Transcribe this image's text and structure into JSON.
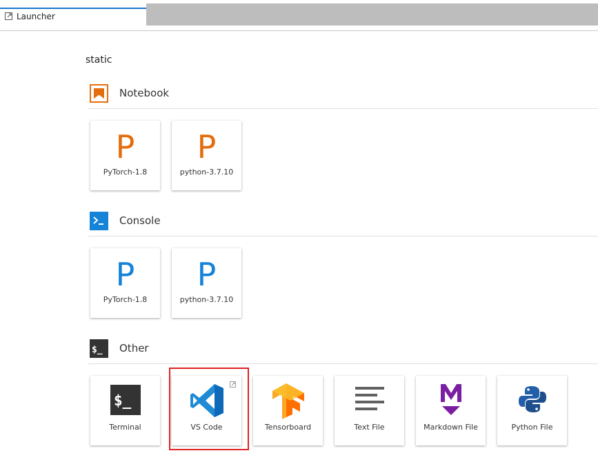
{
  "tab": {
    "label": "Launcher",
    "icon": "launcher-icon"
  },
  "section_root": "static",
  "colors": {
    "notebook": "#e46e0d",
    "console": "#1583d8",
    "other": "#333333",
    "highlight": "#e02020",
    "tab_accent": "#1976d2"
  },
  "sections": {
    "notebook": {
      "title": "Notebook",
      "icon": "notebook-icon",
      "items": [
        {
          "glyph": "P",
          "label": "PyTorch-1.8"
        },
        {
          "glyph": "P",
          "label": "python-3.7.10"
        }
      ]
    },
    "console": {
      "title": "Console",
      "icon": "console-icon",
      "items": [
        {
          "glyph": "P",
          "label": "PyTorch-1.8"
        },
        {
          "glyph": "P",
          "label": "python-3.7.10"
        }
      ]
    },
    "other": {
      "title": "Other",
      "icon": "terminal-prompt-icon",
      "items": [
        {
          "label": "Terminal",
          "icon": "terminal-icon"
        },
        {
          "label": "VS Code",
          "icon": "vscode-icon"
        },
        {
          "label": "Tensorboard",
          "icon": "tensorboard-icon"
        },
        {
          "label": "Text File",
          "icon": "text-file-icon"
        },
        {
          "label": "Markdown File",
          "icon": "markdown-icon"
        },
        {
          "label": "Python File",
          "icon": "python-icon"
        }
      ]
    }
  }
}
